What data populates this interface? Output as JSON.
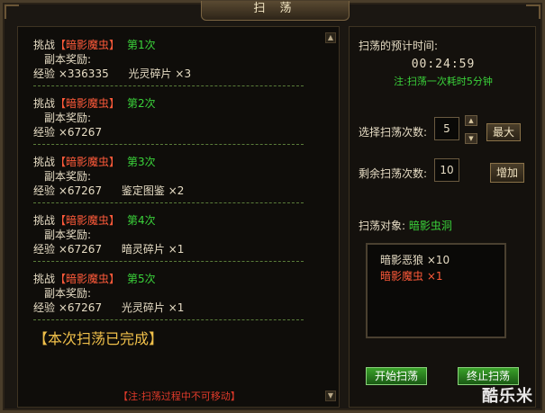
{
  "window": {
    "title": "扫 荡"
  },
  "log": {
    "entries": [
      {
        "prefix": "挑战",
        "monster": "【暗影魔虫】",
        "count": "第1次",
        "reward_label": "副本奖励:",
        "exp_label": "经验",
        "exp_value": "×336335",
        "item_name": "光灵碎片",
        "item_qty": "×3"
      },
      {
        "prefix": "挑战",
        "monster": "【暗影魔虫】",
        "count": "第2次",
        "reward_label": "副本奖励:",
        "exp_label": "经验",
        "exp_value": "×67267",
        "item_name": "",
        "item_qty": ""
      },
      {
        "prefix": "挑战",
        "monster": "【暗影魔虫】",
        "count": "第3次",
        "reward_label": "副本奖励:",
        "exp_label": "经验",
        "exp_value": "×67267",
        "item_name": "鉴定图鉴",
        "item_qty": "×2"
      },
      {
        "prefix": "挑战",
        "monster": "【暗影魔虫】",
        "count": "第4次",
        "reward_label": "副本奖励:",
        "exp_label": "经验",
        "exp_value": "×67267",
        "item_name": "暗灵碎片",
        "item_qty": "×1"
      },
      {
        "prefix": "挑战",
        "monster": "【暗影魔虫】",
        "count": "第5次",
        "reward_label": "副本奖励:",
        "exp_label": "经验",
        "exp_value": "×67267",
        "item_name": "光灵碎片",
        "item_qty": "×1"
      }
    ],
    "complete": "【本次扫荡已完成】",
    "warning": "【注:扫荡过程中不可移动】"
  },
  "scroll": {
    "up": "▲",
    "down": "▼"
  },
  "right": {
    "time_label": "扫荡的预计时间:",
    "time_value": "00:24:59",
    "time_note": "注:扫荡一次耗时5分钟",
    "select_label": "选择扫荡次数:",
    "select_value": "5",
    "max_button": "最大",
    "remain_label": "剩余扫荡次数:",
    "remain_value": "10",
    "add_button": "增加",
    "target_label": "扫荡对象:",
    "target_name": "暗影虫洞",
    "targets": [
      {
        "name": "暗影恶狼",
        "qty": "×10"
      },
      {
        "name": "暗影魔虫",
        "qty": "×1"
      }
    ],
    "start_button": "开始扫荡",
    "stop_button": "终止扫荡"
  },
  "watermark": "酷乐米",
  "colors": {
    "monster_red": "#ff5a3a",
    "count_green": "#3ad23a",
    "complete_gold": "#f0c04a",
    "warning_red": "#e03a2a"
  }
}
